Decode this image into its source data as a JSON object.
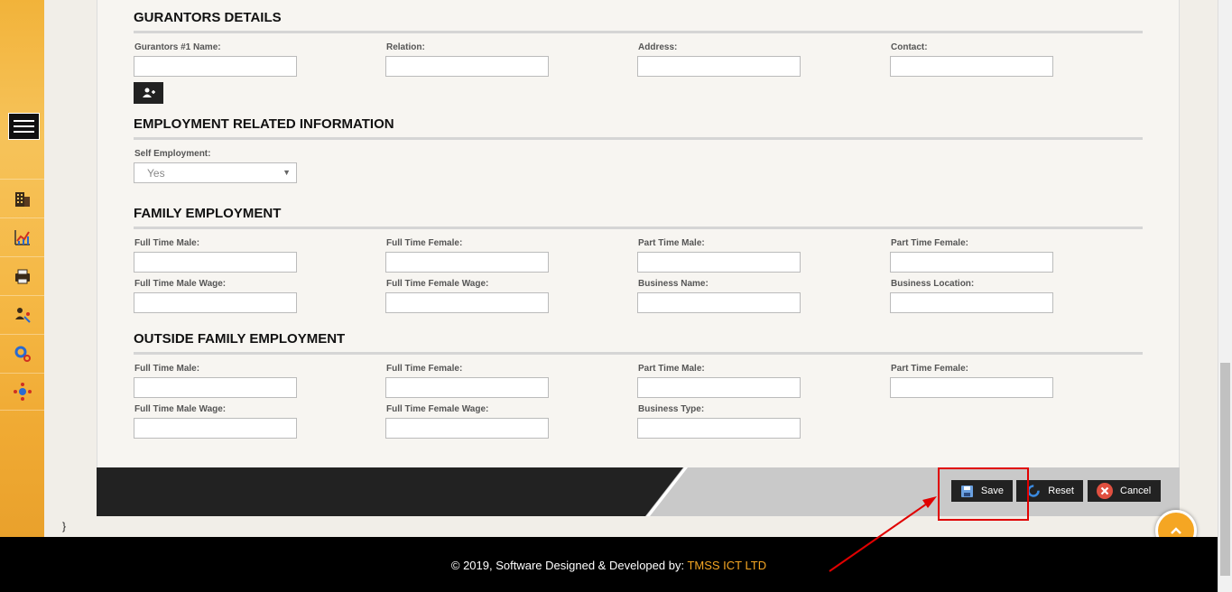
{
  "sidebar": {
    "icons": [
      "building-icon",
      "chart-icon",
      "printer-icon",
      "user-tools-icon",
      "gears-icon",
      "network-icon"
    ]
  },
  "guarantors": {
    "title": "GURANTORS DETAILS",
    "fields": [
      "Gurantors #1 Name:",
      "Relation:",
      "Address:",
      "Contact:"
    ]
  },
  "employment": {
    "title": "EMPLOYMENT RELATED INFORMATION",
    "self_employment_label": "Self Employment:",
    "self_employment_value": "Yes"
  },
  "family_employment": {
    "title": "FAMILY EMPLOYMENT",
    "row1": [
      "Full Time Male:",
      "Full Time Female:",
      "Part Time Male:",
      "Part Time Female:"
    ],
    "row2": [
      "Full Time Male Wage:",
      "Full Time Female Wage:",
      "Business Name:",
      "Business Location:"
    ]
  },
  "outside_family_employment": {
    "title": "OUTSIDE FAMILY EMPLOYMENT",
    "row1": [
      "Full Time Male:",
      "Full Time Female:",
      "Part Time Male:",
      "Part Time Female:"
    ],
    "row2": [
      "Full Time Male Wage:",
      "Full Time Female Wage:",
      "Business Type:"
    ]
  },
  "actions": {
    "save": "Save",
    "reset": "Reset",
    "cancel": "Cancel"
  },
  "stray_text": "}",
  "footer": {
    "text": "© 2019, Software Designed & Developed by: ",
    "brand": "TMSS ICT LTD"
  },
  "colors": {
    "accent": "#f5a623",
    "annotation": "#e00000"
  }
}
